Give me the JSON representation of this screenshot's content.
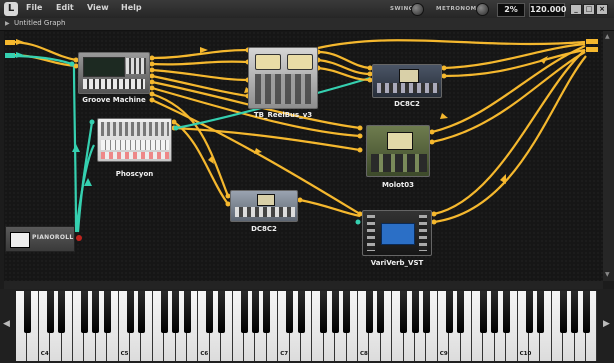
{
  "app": {
    "logo": "L"
  },
  "menu": {
    "items": [
      "File",
      "Edit",
      "View",
      "Help"
    ]
  },
  "transport": {
    "swing_label": "SWING",
    "metronome_label": "METRONOME",
    "swing_value": "2%",
    "tempo": "120.000"
  },
  "window_buttons": {
    "minimize": "_",
    "restore": "□",
    "close": "×"
  },
  "graph": {
    "title": "Untitled Graph"
  },
  "nodes": {
    "groove_machine": "Groove Machine",
    "phoscyon": "Phoscyon",
    "reelbus": "TB_ReelBus_v3",
    "dc8c2_top": "DC8C2",
    "molot": "Molot03",
    "dc8c2_mid": "DC8C2",
    "variverb": "VariVerb_VST",
    "pianoroll": "PIANOROLL"
  },
  "keyboard": {
    "octave_labels": [
      "C4",
      "C5",
      "C6",
      "C7",
      "C8",
      "C9",
      "C10"
    ]
  },
  "colors": {
    "wire_audio": "#f5b82e",
    "wire_midi": "#35d0b0",
    "midi_port": "#c0241e"
  },
  "icons": {
    "menu_logo": "app-logo-icon",
    "swing": "knob-icon",
    "metronome": "knob-icon",
    "scroll_left": "chevron-left-icon",
    "scroll_right": "chevron-right-icon"
  }
}
